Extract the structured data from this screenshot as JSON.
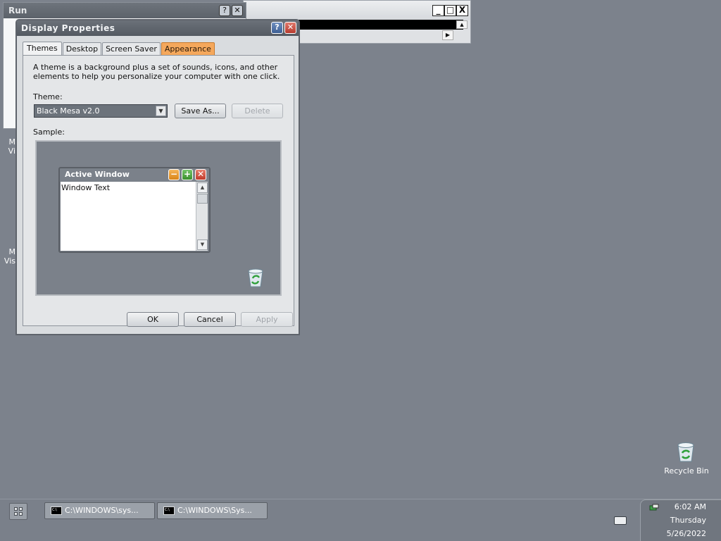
{
  "background_windows": {
    "run_title": "Run",
    "cmd_buttons": [
      "_",
      "□",
      "X"
    ]
  },
  "dialog": {
    "title": "Display Properties",
    "tabs": [
      {
        "label": "Themes",
        "active": true
      },
      {
        "label": "Desktop",
        "active": false
      },
      {
        "label": "Screen Saver",
        "active": false
      },
      {
        "label": "Appearance",
        "active": false,
        "hover": true
      }
    ],
    "description": "A theme is a background plus a set of sounds, icons, and other elements to help you personalize your computer with one click.",
    "theme_label": "Theme:",
    "theme_value": "Black Mesa v2.0",
    "save_as_label": "Save As...",
    "delete_label": "Delete",
    "sample_label": "Sample:",
    "sample_window_title": "Active Window",
    "sample_window_text": "Window Text",
    "ok_label": "OK",
    "cancel_label": "Cancel",
    "apply_label": "Apply"
  },
  "desktop": {
    "partial_icon_1": [
      "M",
      "Vi"
    ],
    "partial_icon_2": [
      "M",
      "Vis"
    ],
    "recycle_bin_label": "Recycle Bin"
  },
  "taskbar": {
    "tasks": [
      {
        "label": "C:\\WINDOWS\\sys..."
      },
      {
        "label": "C:\\WINDOWS\\Sys..."
      }
    ],
    "clock": {
      "time": "6:02 AM",
      "day": "Thursday",
      "date": "5/26/2022"
    }
  },
  "colors": {
    "desktop": "#7c828c",
    "accent_tab": "#f5a85c",
    "titlebar": "#5e646c"
  }
}
